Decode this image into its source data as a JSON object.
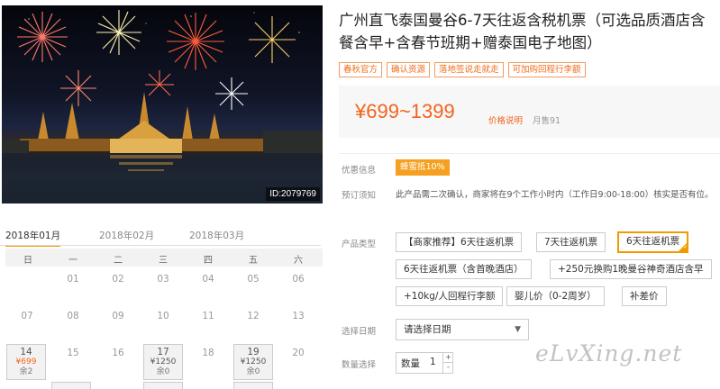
{
  "hero": {
    "image_id": "ID:2079769"
  },
  "product": {
    "title_line1": "广州直飞泰国曼谷6-7天往返含税机票（可选品质酒店含",
    "title_line2": "餐含早+含春节班期+赠泰国电子地图）",
    "tags": [
      "春秋官方",
      "确认资源",
      "落地签说走就走",
      "可加购回程行李额"
    ],
    "price": "¥699~1399",
    "price_note": "价格说明",
    "sold": "月售91"
  },
  "info": {
    "promo_label": "优惠信息",
    "promo_badge": "蜂蜜抵10%",
    "notice_label": "预订须知",
    "notice_text": "此产品需二次确认，商家将在9个工作小时内（工作日9:00-18:00）核实是否有位。"
  },
  "options": {
    "label": "产品类型",
    "items": [
      "【商家推荐】6天往返机票",
      "7天往返机票",
      "6天往返机票",
      "6天往返机票（含首晚酒店）",
      "+250元换购1晚曼谷神奇酒店含早",
      "+10kg/人回程行李额",
      "婴儿价（0-2周岁）",
      "补差价"
    ],
    "selected_index": 2
  },
  "date": {
    "label": "选择日期",
    "placeholder": "请选择日期"
  },
  "quantity": {
    "label": "数量选择",
    "field_label": "数量",
    "value": "1",
    "plus": "+",
    "minus": "-"
  },
  "watermark": "eLvXing.net",
  "calendar": {
    "tabs": [
      "2018年01月",
      "2018年02月",
      "2018年03月"
    ],
    "active_tab": 0,
    "weekdays": [
      "日",
      "一",
      "二",
      "三",
      "四",
      "五",
      "六"
    ],
    "row1": [
      "01",
      "02",
      "03",
      "04",
      "05",
      "06"
    ],
    "row2": [
      "07",
      "08",
      "09",
      "10",
      "11",
      "12",
      "13"
    ],
    "row3": [
      {
        "day": "14",
        "price": "¥699",
        "stock": "余2"
      },
      {
        "day": "15"
      },
      {
        "day": "16"
      },
      {
        "day": "17",
        "price": "¥1250",
        "stock": "余0"
      },
      {
        "day": "18"
      },
      {
        "day": "19",
        "price": "¥1250",
        "stock": "余0"
      },
      {
        "day": "20"
      }
    ]
  },
  "colors": {
    "accent": "#f2631c",
    "selected_border": "#f29b00",
    "badge": "#f5a020"
  }
}
